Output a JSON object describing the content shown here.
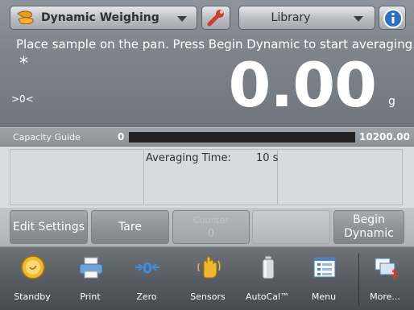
{
  "header": {
    "mode_label": "Dynamic Weighing",
    "library_label": "Library",
    "instruction": "Place sample on the pan.  Press Begin Dynamic to start averaging.",
    "stability_indicator": "*",
    "zero_indicator": ">0<",
    "weight_value": "0.00",
    "unit": "g"
  },
  "capacity_guide": {
    "label": "Capacity Guide",
    "min": "0",
    "max": "10200.00",
    "fill_fraction": 0.0,
    "fill_color": "#5bd05b"
  },
  "info": {
    "averaging_label": "Averaging Time:",
    "averaging_value": "10 s"
  },
  "actions": {
    "edit_settings": "Edit Settings",
    "tare": "Tare",
    "counter_label": "Counter",
    "counter_value": "0",
    "begin_line1": "Begin",
    "begin_line2": "Dynamic"
  },
  "nav": {
    "items": [
      {
        "label": "Standby",
        "icon": "standby-icon"
      },
      {
        "label": "Print",
        "icon": "printer-icon"
      },
      {
        "label": "Zero",
        "icon": "zero-icon"
      },
      {
        "label": "Sensors",
        "icon": "hand-sensor-icon"
      },
      {
        "label": "AutoCal™",
        "icon": "calibration-weight-icon"
      },
      {
        "label": "Menu",
        "icon": "menu-icon"
      },
      {
        "label": "More...",
        "icon": "more-icon"
      }
    ]
  },
  "colors": {
    "header_bg": "#7e848c",
    "accent_orange": "#e08a1a",
    "info_blue": "#2e6fc2"
  }
}
